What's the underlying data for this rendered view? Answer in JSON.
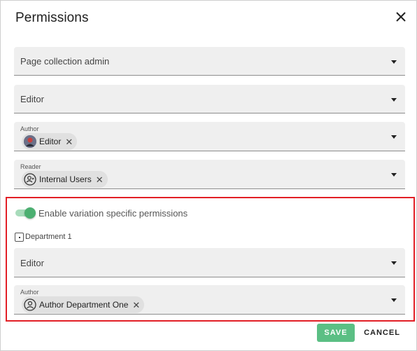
{
  "dialog": {
    "title": "Permissions",
    "close_icon": "close-icon"
  },
  "fields": {
    "page_collection_admin": {
      "value": "Page collection admin"
    },
    "editor": {
      "value": "Editor"
    },
    "author": {
      "label": "Author",
      "chips": [
        {
          "label": "Editor",
          "icon": "editor-avatar-icon"
        }
      ]
    },
    "reader": {
      "label": "Reader",
      "chips": [
        {
          "label": "Internal Users",
          "icon": "user-group-icon"
        }
      ]
    }
  },
  "variation": {
    "toggle_on": true,
    "toggle_label": "Enable variation specific permissions",
    "department_label": "Department 1",
    "editor": {
      "value": "Editor"
    },
    "author": {
      "label": "Author",
      "chips": [
        {
          "label": "Author Department One",
          "icon": "user-icon"
        }
      ]
    }
  },
  "actions": {
    "save_label": "SAVE",
    "cancel_label": "CANCEL"
  },
  "colors": {
    "accent_green": "#5bbf84",
    "highlight_red": "#e21f26",
    "field_bg": "#efefef"
  }
}
